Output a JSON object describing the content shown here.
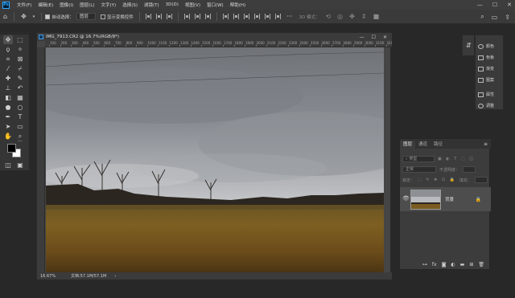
{
  "app": {
    "logo": "Ps"
  },
  "menu": [
    "文件(F)",
    "编辑(E)",
    "图像(I)",
    "图层(L)",
    "文字(Y)",
    "选择(S)",
    "滤镜(T)",
    "3D(D)",
    "视图(V)",
    "窗口(W)",
    "帮助(H)"
  ],
  "window_controls": {
    "minimize": "—",
    "maximize": "☐",
    "close": "✕"
  },
  "options_bar": {
    "auto_select_label": "自动选择：",
    "auto_select_value": "图层",
    "show_transform_label": "显示变换控件",
    "mode_3d_label": "3D 模式："
  },
  "document": {
    "title": "IMG_7913.CR2 @ 16.7%(RGB/8*)",
    "ruler_labels": [
      "100",
      "200",
      "300",
      "400",
      "500",
      "600",
      "700",
      "800",
      "900",
      "1000",
      "1100",
      "1200",
      "1300",
      "1400",
      "1500",
      "1600",
      "1700",
      "1800",
      "1900",
      "2000",
      "2100",
      "2200",
      "2300",
      "2400",
      "2500",
      "2600",
      "2700",
      "2800",
      "2900",
      "3000",
      "3100",
      "3200",
      "3300",
      "3400",
      "3500",
      "3600",
      "3700",
      "3800",
      "4000",
      "4100",
      "4200",
      "4300",
      "4400",
      "4500",
      "4600",
      "4700",
      "4800",
      "5000",
      "5100",
      "5200",
      "5300",
      "5400",
      "5500"
    ],
    "zoom": "16.67%",
    "doc_size": "文档:57.1M/57.1M",
    "status_arrow": "›"
  },
  "dock_panel": {
    "items": [
      "颜色",
      "色板",
      "渐变",
      "图案",
      "属性",
      "调整"
    ]
  },
  "layers_panel": {
    "tabs": [
      "图层",
      "通道",
      "路径"
    ],
    "filter_label": "类型",
    "blend_mode": "正常",
    "opacity_label": "不透明度：",
    "lock_label": "锁定：",
    "fill_label": "填充：",
    "layer_name": "背景"
  }
}
